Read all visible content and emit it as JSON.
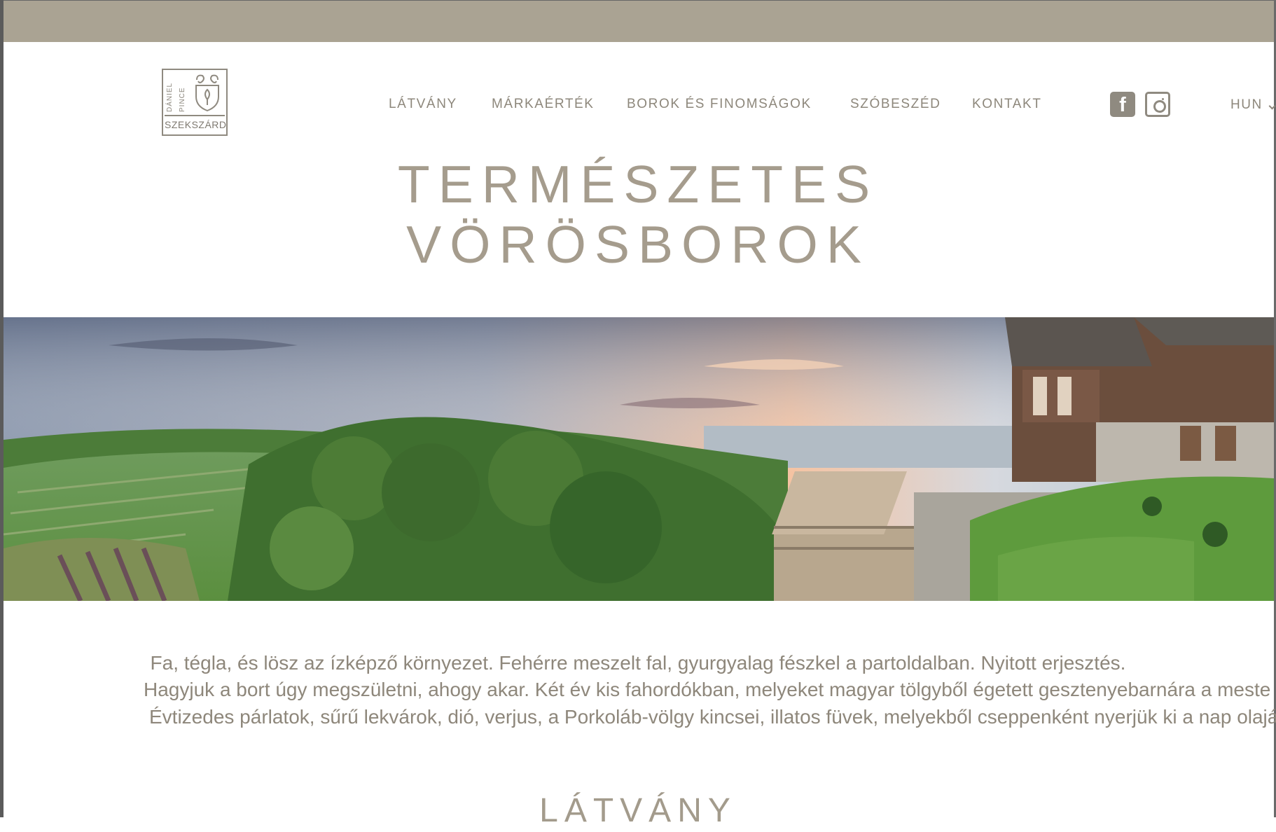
{
  "logo": {
    "line1": "DÁNIEL",
    "line2": "PINCE",
    "city": "SZEKSZÁRD"
  },
  "nav": [
    {
      "label": "LÁTVÁNY"
    },
    {
      "label": "MÁRKAÉRTÉK"
    },
    {
      "label": "BOROK ÉS FINOMSÁGOK"
    },
    {
      "label": "SZÓBESZÉD"
    },
    {
      "label": "KONTAKT"
    }
  ],
  "social": {
    "facebook": "f",
    "instagram_icon": "instagram-icon",
    "facebook_icon": "facebook-icon"
  },
  "language": {
    "selected": "HUN"
  },
  "hero_title": {
    "line1": "TERMÉSZETES",
    "line2": "VÖRÖSBOROK"
  },
  "intro": [
    "Fa, tégla, és lösz az ízképző környezet. Fehérre meszelt fal, gyurgyalag fészkel a partoldalban. Nyitott erjesztés.",
    "Hagyjuk a bort úgy megszületni, ahogy akar. Két év kis fahordókban, melyeket magyar tölgyből égetett gesztenyebarnára a meste",
    "Évtizedes párlatok, sűrű lekvárok, dió, verjus, a Porkoláb-völgy kincsei, illatos füvek, melyekből cseppenként nyerjük ki a nap olajá"
  ],
  "section": {
    "title": "LÁTVÁNY"
  },
  "colors": {
    "topbar": "#aaa393",
    "text": "#8e877b",
    "title": "#a59c8d"
  }
}
